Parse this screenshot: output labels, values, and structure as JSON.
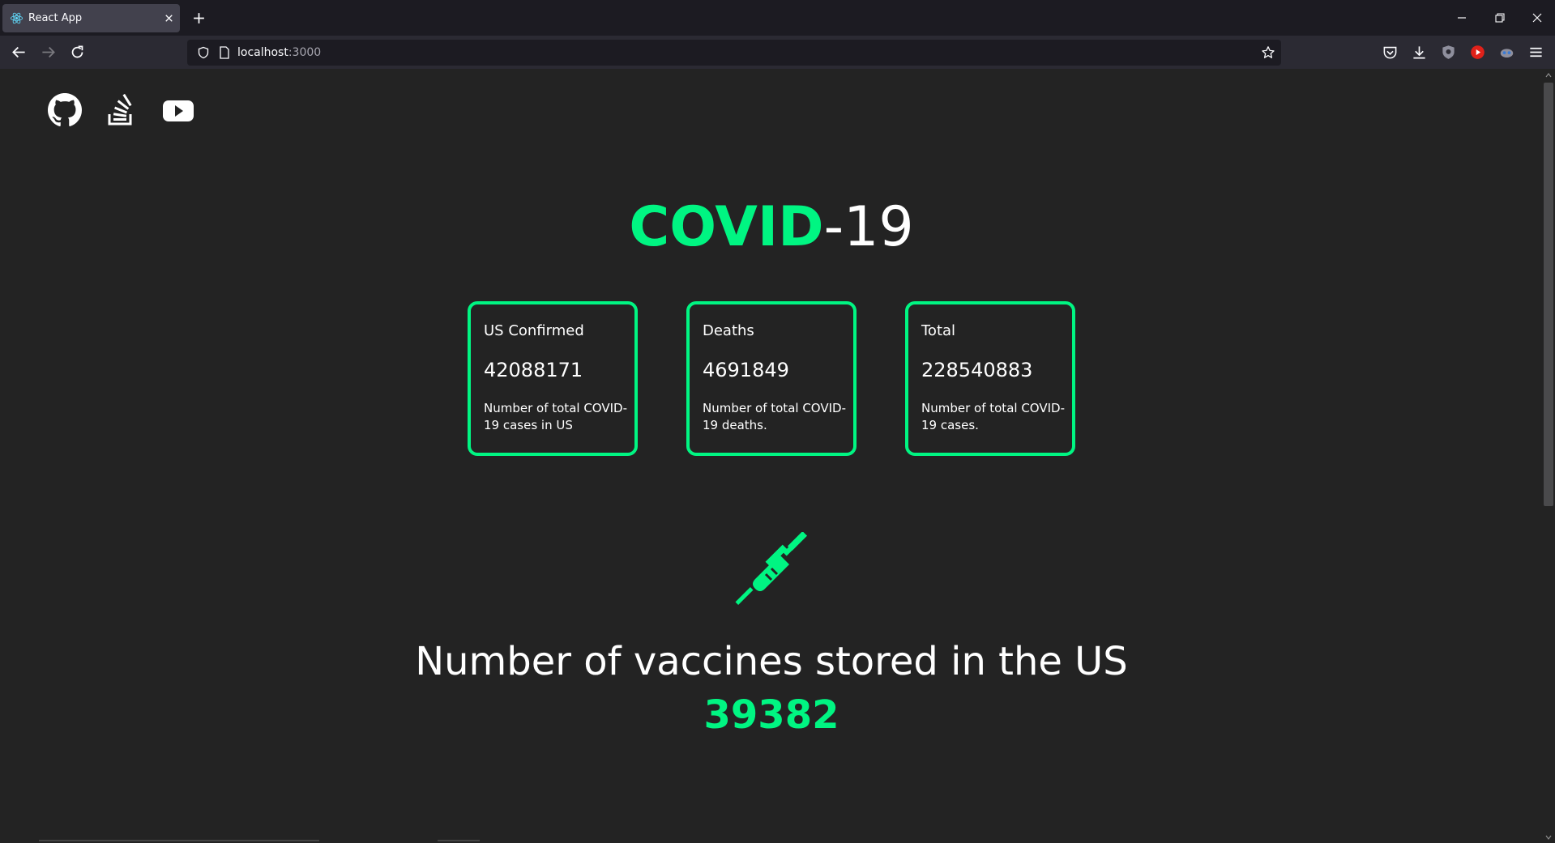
{
  "browser": {
    "tab_title": "React App",
    "url_host": "localhost",
    "url_port": ":3000"
  },
  "page": {
    "title_highlight": "COVID",
    "title_rest": "-19",
    "social_icons": [
      "github-icon",
      "stackoverflow-icon",
      "youtube-icon"
    ],
    "cards": [
      {
        "label": "US Confirmed",
        "value": "42088171",
        "description": "Number of total COVID-19 cases in US"
      },
      {
        "label": "Deaths",
        "value": "4691849",
        "description": "Number of total COVID-19 deaths."
      },
      {
        "label": "Total",
        "value": "228540883",
        "description": "Number of total COVID-19 cases."
      }
    ],
    "vaccine_label": "Number of vaccines stored in the US",
    "vaccine_count": "39382"
  },
  "colors": {
    "accent": "#00f582",
    "background": "#232323",
    "text": "#ffffff"
  }
}
